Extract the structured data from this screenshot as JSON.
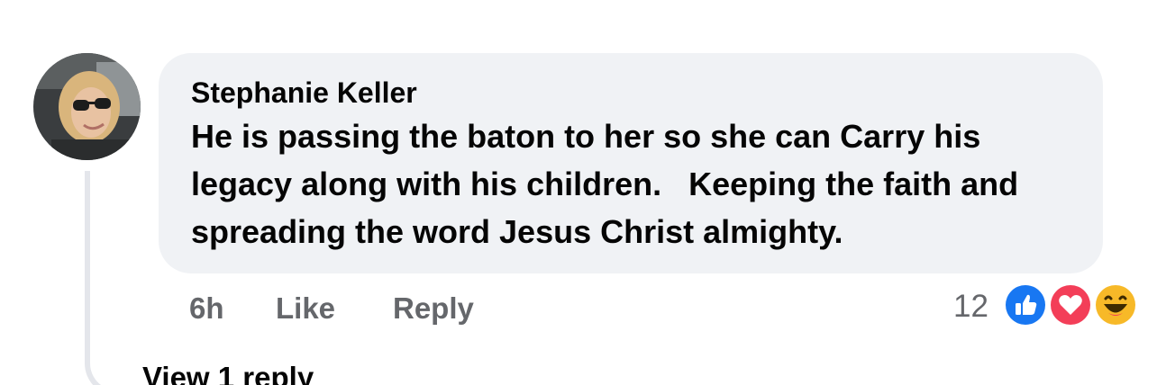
{
  "comment": {
    "author": "Stephanie Keller",
    "text": "He is passing the baton to her so she can Carry his legacy along with his children.   Keeping the faith and spreading the word Jesus Christ almighty.",
    "time": "6h",
    "like_label": "Like",
    "reply_label": "Reply",
    "reaction_count": "12",
    "reactions": [
      "like-reaction-icon",
      "love-reaction-icon",
      "haha-reaction-icon"
    ]
  },
  "view_replies_label": "View 1 reply",
  "colors": {
    "bubble": "#f0f2f5",
    "text": "#050505",
    "secondary": "#65676b",
    "like_blue": "#1877f2",
    "love_red": "#f33e58",
    "haha_yellow": "#f7b928"
  }
}
